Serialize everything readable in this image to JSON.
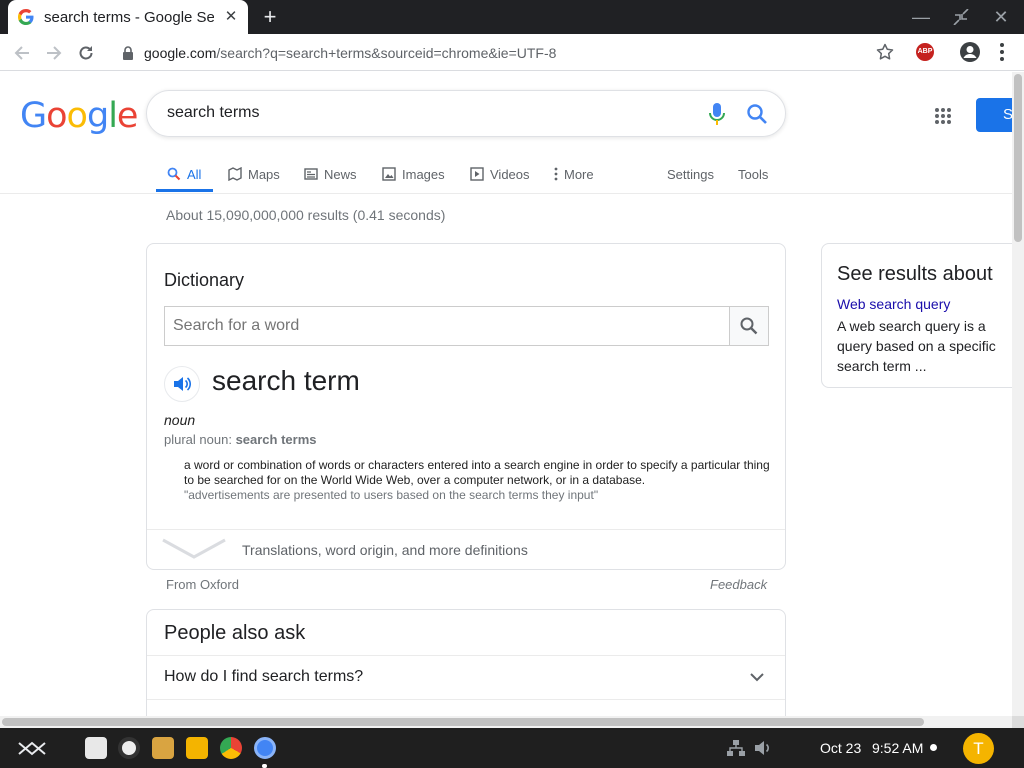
{
  "browser": {
    "tab_title": "search terms - Google Se",
    "new_tab_symbol": "+",
    "address": {
      "host": "google.com",
      "path": "/search?q=search+terms&sourceid=chrome&ie=UTF-8"
    },
    "adblock_badge": "ABP"
  },
  "search": {
    "logo_letters": [
      "G",
      "o",
      "o",
      "g",
      "l",
      "e"
    ],
    "logo_colors": [
      "#4285F4",
      "#EA4335",
      "#FBBC05",
      "#4285F4",
      "#34A853",
      "#EA4335"
    ],
    "query": "search terms",
    "signin_label": "S",
    "tabs": [
      {
        "label": "All",
        "icon": "search-icon",
        "active": true
      },
      {
        "label": "Maps",
        "icon": "map-icon"
      },
      {
        "label": "News",
        "icon": "news-icon"
      },
      {
        "label": "Images",
        "icon": "image-icon"
      },
      {
        "label": "Videos",
        "icon": "video-icon"
      },
      {
        "label": "More",
        "icon": "more-vert-icon"
      }
    ],
    "settings_label": "Settings",
    "tools_label": "Tools",
    "result_stats": "About 15,090,000,000 results (0.41 seconds)"
  },
  "dictionary": {
    "heading": "Dictionary",
    "input_placeholder": "Search for a word",
    "headword": "search term",
    "part_of_speech": "noun",
    "plural_prefix": "plural noun: ",
    "plural_word": "search terms",
    "definition": "a word or combination of words or characters entered into a search engine in order to specify a particular thing to be searched for on the World Wide Web, over a computer network, or in a database.",
    "example": "\"advertisements are presented to users based on the search terms they input\"",
    "more_label": "Translations, word origin, and more definitions",
    "source": "From Oxford",
    "feedback": "Feedback"
  },
  "people_also_ask": {
    "heading": "People also ask",
    "questions": [
      "How do I find search terms?"
    ]
  },
  "side_panel": {
    "heading": "See results about",
    "link": "Web search query",
    "description": "A web search query is a query based on a specific search term ..."
  },
  "shelf": {
    "date": "Oct 23",
    "time": "9:52 AM",
    "avatar_letter": "T",
    "accent": "#1a73e8"
  }
}
